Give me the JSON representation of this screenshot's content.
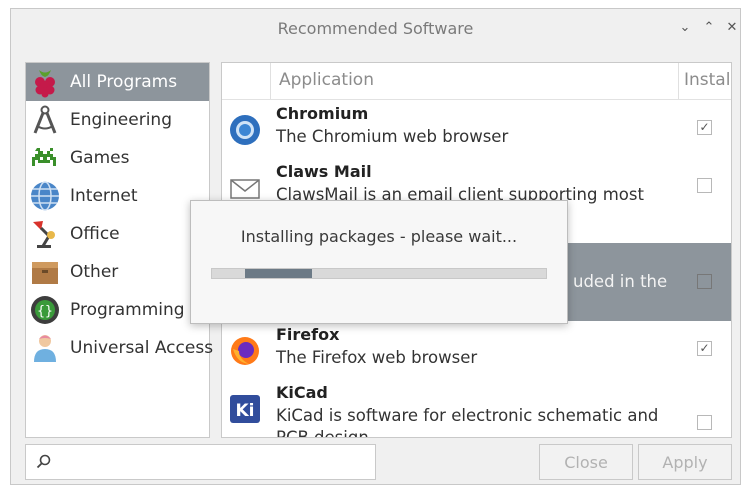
{
  "window": {
    "title": "Recommended Software",
    "controls": [
      "⌄",
      "⌃",
      "✕"
    ]
  },
  "sidebar": {
    "items": [
      {
        "label": "All Programs",
        "icon": "raspberry-icon",
        "selected": true
      },
      {
        "label": "Engineering",
        "icon": "compass-icon",
        "selected": false
      },
      {
        "label": "Games",
        "icon": "space-invader-icon",
        "selected": false
      },
      {
        "label": "Internet",
        "icon": "globe-icon",
        "selected": false
      },
      {
        "label": "Office",
        "icon": "desk-lamp-icon",
        "selected": false
      },
      {
        "label": "Other",
        "icon": "box-icon",
        "selected": false
      },
      {
        "label": "Programming",
        "icon": "code-braces-icon",
        "selected": false
      },
      {
        "label": "Universal Access",
        "icon": "person-icon",
        "selected": false
      }
    ]
  },
  "list": {
    "columns": {
      "application": "Application",
      "install": "Install"
    },
    "rows": [
      {
        "name": "Chromium",
        "desc": "The Chromium web browser",
        "icon": "chromium-icon",
        "checked": true,
        "selected": false
      },
      {
        "name": "Claws Mail",
        "desc": "ClawsMail is an email client supporting most",
        "icon": "envelope-icon",
        "checked": false,
        "selected": false
      },
      {
        "name": "",
        "desc": "uded in the",
        "icon": "",
        "checked": false,
        "selected": true
      },
      {
        "name": "Firefox",
        "desc": "The Firefox web browser",
        "icon": "firefox-icon",
        "checked": true,
        "selected": false
      },
      {
        "name": "KiCad",
        "desc": "KiCad is software for electronic schematic and",
        "desc2": "PCB design",
        "icon": "kicad-icon",
        "checked": false,
        "selected": false
      }
    ]
  },
  "search": {
    "placeholder": "",
    "value": ""
  },
  "buttons": {
    "close": "Close",
    "apply": "Apply"
  },
  "dialog": {
    "message": "Installing packages - please wait...",
    "progress": {
      "start": 0.1,
      "end": 0.3
    }
  },
  "colors": {
    "selection": "#8d959c",
    "progress": "#6c7a86"
  }
}
